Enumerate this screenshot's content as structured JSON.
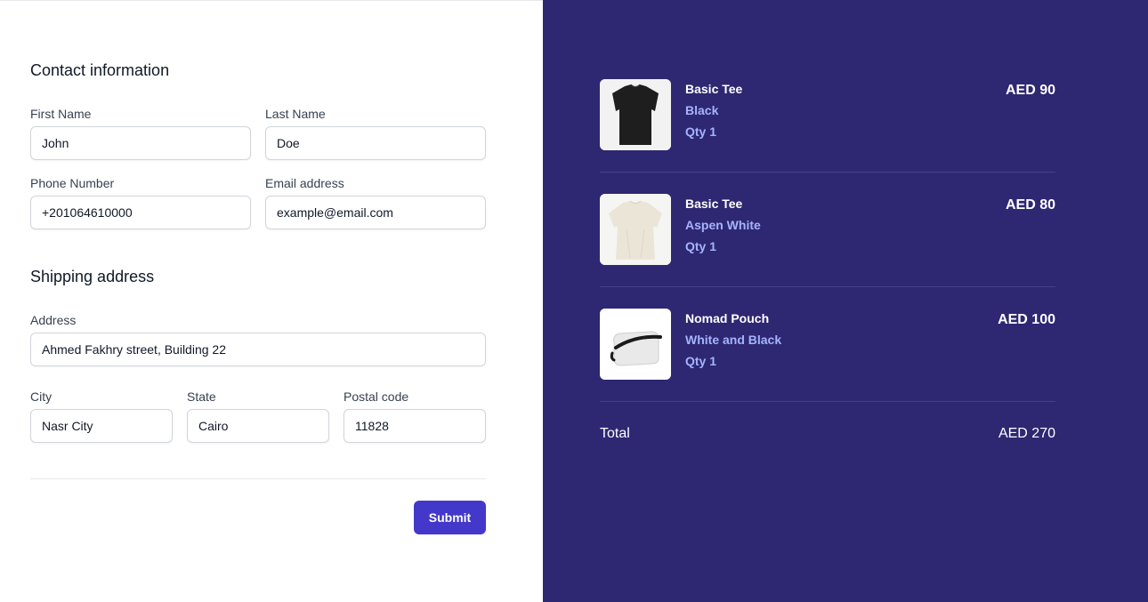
{
  "contact": {
    "heading": "Contact information",
    "first_name": {
      "label": "First Name",
      "value": "John"
    },
    "last_name": {
      "label": "Last Name",
      "value": "Doe"
    },
    "phone": {
      "label": "Phone Number",
      "value": "+201064610000"
    },
    "email": {
      "label": "Email address",
      "value": "example@email.com"
    }
  },
  "shipping": {
    "heading": "Shipping address",
    "address": {
      "label": "Address",
      "value": "Ahmed Fakhry street, Building 22"
    },
    "city": {
      "label": "City",
      "value": "Nasr City"
    },
    "state": {
      "label": "State",
      "value": "Cairo"
    },
    "postal": {
      "label": "Postal code",
      "value": "11828"
    }
  },
  "submit_label": "Submit",
  "order": {
    "items": [
      {
        "name": "Basic Tee",
        "color": "Black",
        "qty": "Qty 1",
        "price": "AED 90",
        "image": "black-tee"
      },
      {
        "name": "Basic Tee",
        "color": "Aspen White",
        "qty": "Qty 1",
        "price": "AED 80",
        "image": "white-tee"
      },
      {
        "name": "Nomad Pouch",
        "color": "White and Black",
        "qty": "Qty 1",
        "price": "AED 100",
        "image": "nomad-pouch"
      }
    ],
    "total_label": "Total",
    "total_value": "AED 270"
  },
  "colors": {
    "panel_bg": "#2e2772",
    "accent": "#4338ca",
    "variant_text": "#a5b4fc"
  }
}
